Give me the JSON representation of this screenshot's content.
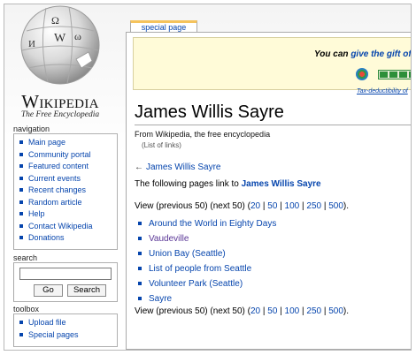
{
  "logo": {
    "wordmark_initial": "W",
    "wordmark_rest": "IKIPEDIA",
    "tagline": "The Free Encyclopedia",
    "puzzle_glyphs": [
      "Ω",
      "W",
      "И",
      "ω"
    ]
  },
  "navigation": {
    "title": "navigation",
    "items": [
      {
        "label": "Main page"
      },
      {
        "label": "Community portal"
      },
      {
        "label": "Featured content"
      },
      {
        "label": "Current events"
      },
      {
        "label": "Recent changes"
      },
      {
        "label": "Random article"
      },
      {
        "label": "Help"
      },
      {
        "label": "Contact Wikipedia"
      },
      {
        "label": "Donations"
      }
    ]
  },
  "search": {
    "title": "search",
    "value": "",
    "go_label": "Go",
    "search_label": "Search"
  },
  "toolbox": {
    "title": "toolbox",
    "items": [
      {
        "label": "Upload file"
      },
      {
        "label": "Special pages"
      }
    ]
  },
  "tab": {
    "label": "special page"
  },
  "sitenotice": {
    "text_prefix": "You can ",
    "link_text": "give the gift of",
    "fine_print": "Tax-deductibility of",
    "progress_segments": 4
  },
  "page": {
    "title": "James Willis Sayre",
    "site_sub": "From Wikipedia, the free encyclopedia",
    "content_sub": "(List of links)",
    "back_link": "James Willis Sayre",
    "back_arrow": "←",
    "intro_prefix": "The following pages link to ",
    "intro_target": "James Willis Sayre",
    "view_top": {
      "prefix": "View (previous 50) (next 50) (",
      "suffix": ")."
    },
    "view_bottom": {
      "prefix": "View (previous 50) (next 50) (",
      "suffix": ")."
    },
    "page_sizes": [
      "20",
      "50",
      "100",
      "250",
      "500"
    ],
    "page_separator": " | ",
    "backlinks": [
      {
        "label": "Around the World in Eighty Days",
        "visited": false
      },
      {
        "label": "Vaudeville",
        "visited": true
      },
      {
        "label": "Union Bay (Seattle)",
        "visited": false
      },
      {
        "label": "List of people from Seattle",
        "visited": false
      },
      {
        "label": "Volunteer Park (Seattle)",
        "visited": false
      },
      {
        "label": "Sayre",
        "visited": false
      }
    ]
  },
  "colors": {
    "link": "#0645ad",
    "visited": "#5a3696",
    "tab_accent": "#f5c35c",
    "notice_bg": "#fffbd8",
    "progress": "#2d8f3a"
  }
}
